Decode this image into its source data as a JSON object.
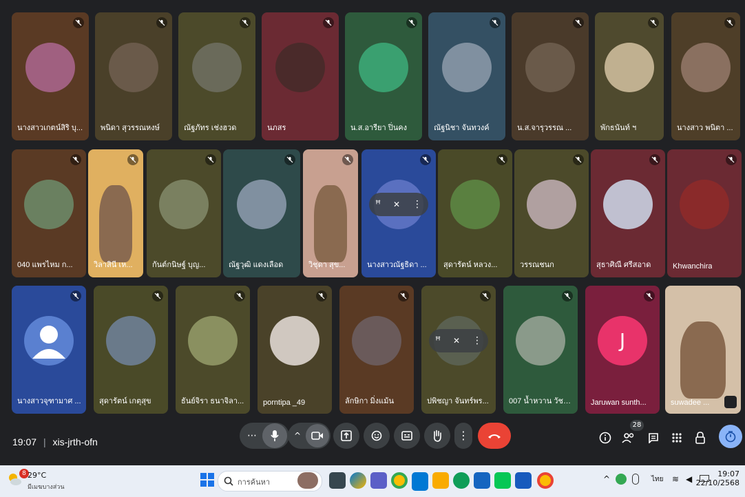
{
  "tiles": {
    "r1": [
      "นางสาวเกตน์สิริ บุ...",
      "พนิดา สุวรรณหงษ์",
      "ณัฐภัทร เช่งฮวด",
      "นภสร",
      "น.ส.อารียา ปิ่นคง",
      "ณัฐนิชา จันทวงค์",
      "น.ส.จารุวรรณ ...",
      "พักธนันท์ ฯ",
      "นางสาว พนิตา ..."
    ],
    "r2": [
      "040 แพรไหม ก...",
      "วิลาสินี เห...",
      "กันต์กนิษฐ์ บุญ...",
      "ณัฐวุฒิ แดงเลือด",
      "วิชุดา สุข...",
      "นางสาวณัฐธิดา ...",
      "สุดารัตน์ หลวง...",
      "วรรณชนก",
      "สุธาศิณี ศรีสอาด",
      "Khwanchira"
    ],
    "r3": [
      "นางสาวจุฑามาศ ...",
      "สุดารัตน์ เกตุสุข",
      "ธันย์จิรา ธนาจิลา...",
      "porntipa _49",
      "ลักษิกา มิ่งแม้น",
      "ปพิชญา จันทร์พร...",
      "007 น้ำหวาน วัชโ...",
      "Jaruwan sunth...",
      "suwadee ..."
    ]
  },
  "avatar_letter": "J",
  "meeting": {
    "time": "19:07",
    "separator": "|",
    "code": "xis-jrth-ofn"
  },
  "participants_count": "28",
  "taskbar": {
    "weather_temp": "29°C",
    "weather_desc": "มีเมฆบางส่วน",
    "weather_badge": "8",
    "search_placeholder": "การค้นหา",
    "lang": "ไทย",
    "clock_time": "19:07",
    "clock_date": "22/10/2568"
  },
  "colors": {
    "end_call": "#ea4335",
    "accent": "#8ab4f8"
  }
}
